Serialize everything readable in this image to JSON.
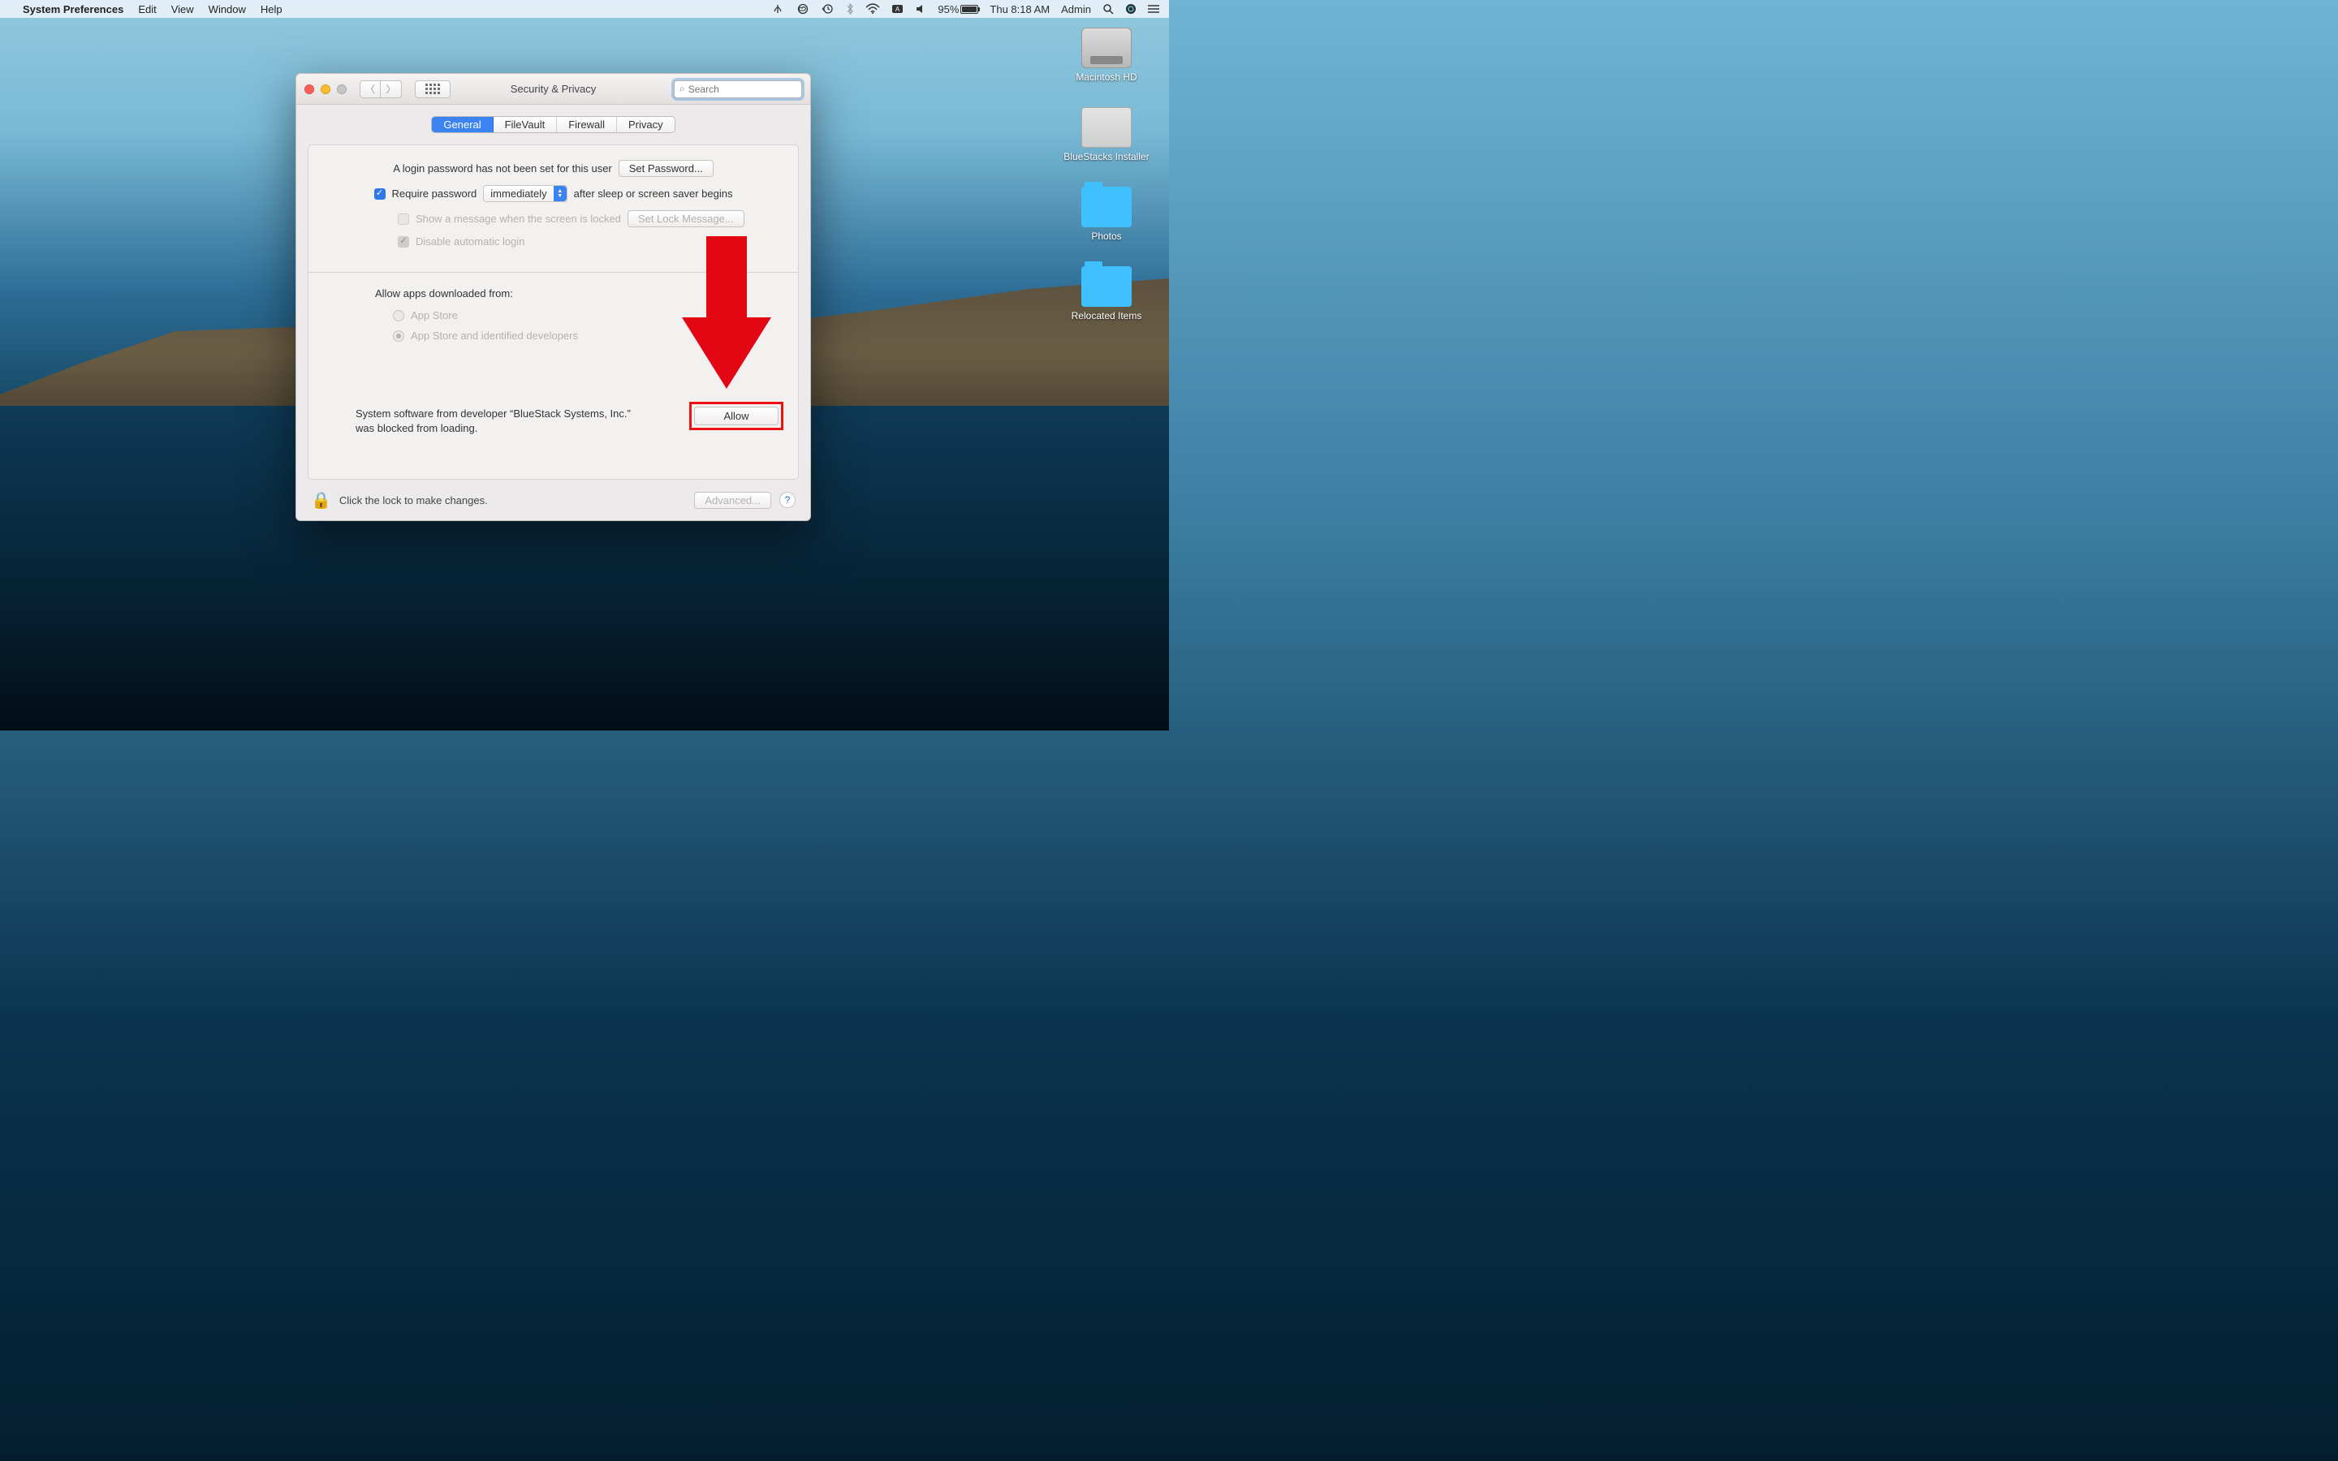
{
  "menubar": {
    "app_name": "System Preferences",
    "menus": [
      "Edit",
      "View",
      "Window",
      "Help"
    ],
    "battery_pct": "95%",
    "clock": "Thu 8:18 AM",
    "user": "Admin"
  },
  "desktop": {
    "icons": [
      {
        "label": "Macintosh HD"
      },
      {
        "label": "BlueStacks Installer"
      },
      {
        "label": "Photos"
      },
      {
        "label": "Relocated Items"
      }
    ]
  },
  "window": {
    "title": "Security & Privacy",
    "search_placeholder": "Search",
    "tabs": [
      "General",
      "FileVault",
      "Firewall",
      "Privacy"
    ],
    "active_tab": "General",
    "login_msg": "A login password has not been set for this user",
    "set_password_btn": "Set Password...",
    "require_pwd_label": "Require password",
    "require_pwd_option": "immediately",
    "require_pwd_suffix": "after sleep or screen saver begins",
    "show_msg_label": "Show a message when the screen is locked",
    "set_lock_msg_btn": "Set Lock Message...",
    "disable_auto_login": "Disable automatic login",
    "allow_apps_heading": "Allow apps downloaded from:",
    "radio_appstore": "App Store",
    "radio_identified": "App Store and identified developers",
    "blocked_text": "System software from developer “BlueStack Systems, Inc.” was blocked from loading.",
    "allow_btn": "Allow",
    "lock_text": "Click the lock to make changes.",
    "advanced_btn": "Advanced..."
  }
}
